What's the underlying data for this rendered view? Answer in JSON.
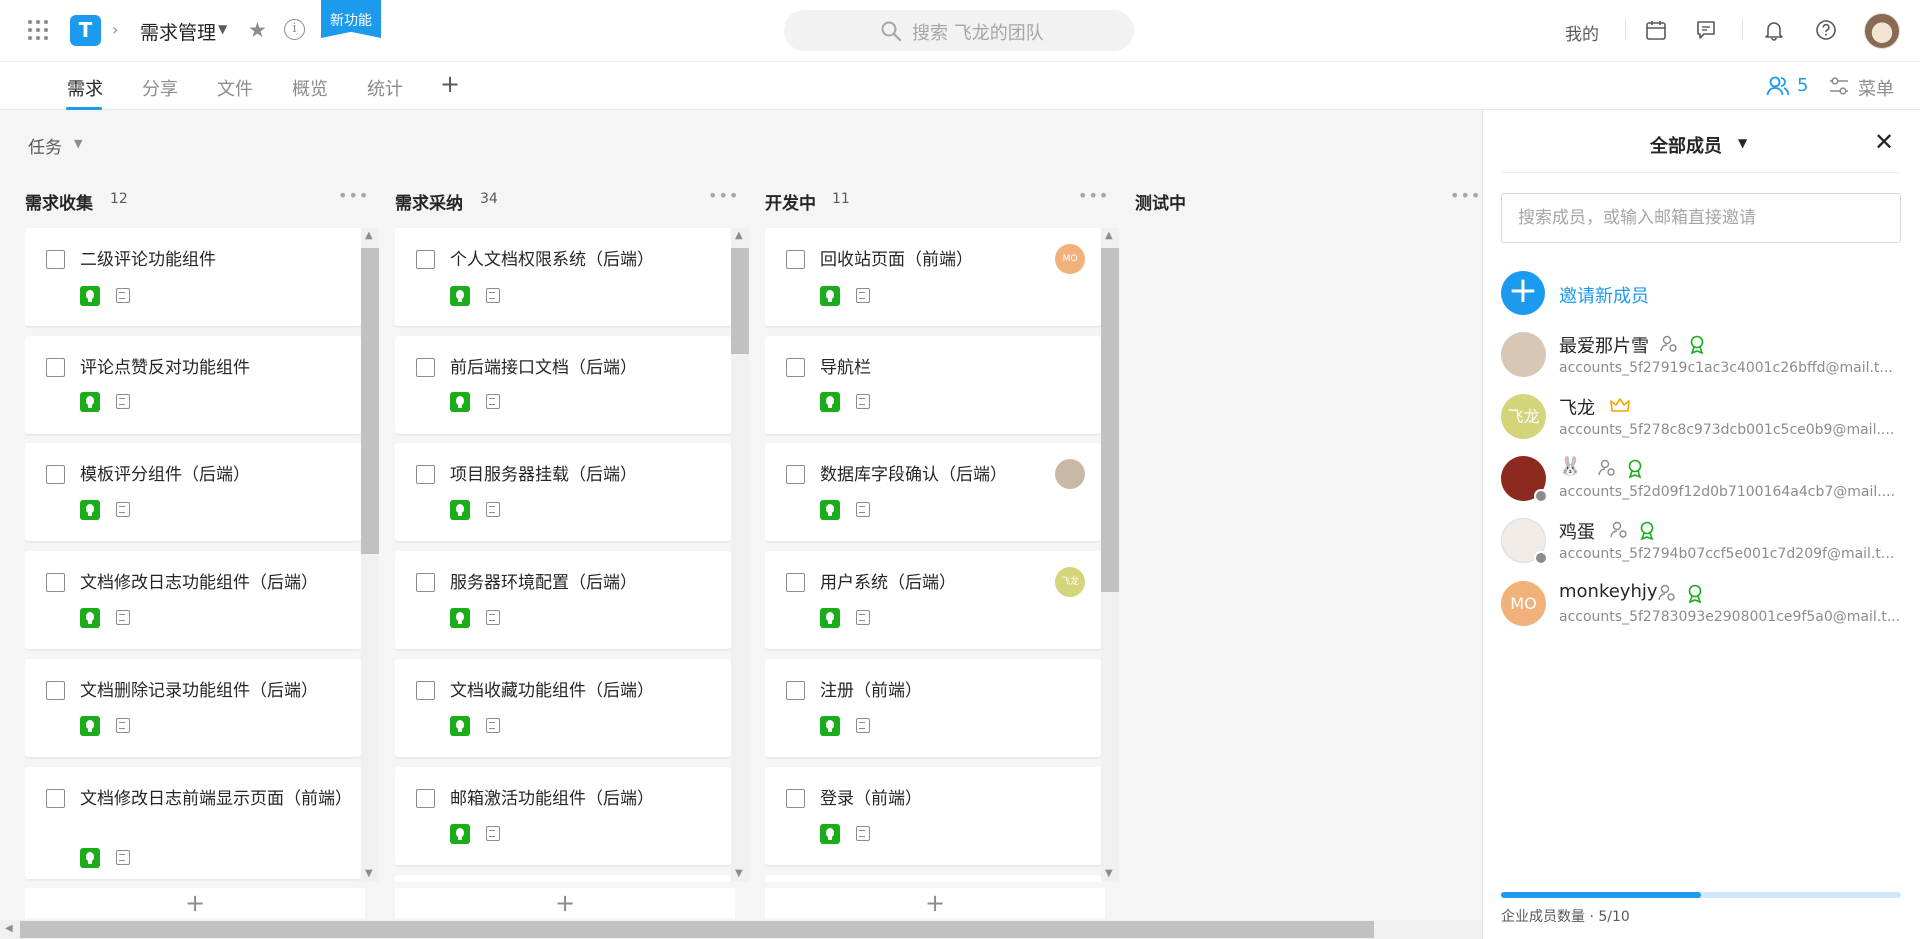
{
  "header": {
    "project_name": "需求管理",
    "new_feature_badge": "新功能",
    "search_placeholder": "搜索 飞龙的团队",
    "mine_label": "我的",
    "logo_letter": "T"
  },
  "tabs": [
    {
      "label": "需求",
      "active": true
    },
    {
      "label": "分享",
      "active": false
    },
    {
      "label": "文件",
      "active": false
    },
    {
      "label": "概览",
      "active": false
    },
    {
      "label": "统计",
      "active": false
    }
  ],
  "toolbar": {
    "tab_add": "+",
    "members_count": "5",
    "menu_label": "菜单"
  },
  "board": {
    "filter_label": "任务",
    "columns": [
      {
        "title": "需求收集",
        "count": "12",
        "cards": [
          {
            "title": "二级评论功能组件"
          },
          {
            "title": "评论点赞反对功能组件"
          },
          {
            "title": "模板评分组件（后端）"
          },
          {
            "title": "文档修改日志功能组件（后端）"
          },
          {
            "title": "文档删除记录功能组件（后端）"
          },
          {
            "title": "文档修改日志前端显示页面（前端）"
          }
        ]
      },
      {
        "title": "需求采纳",
        "count": "34",
        "cards": [
          {
            "title": "个人文档权限系统（后端）"
          },
          {
            "title": "前后端接口文档（后端）"
          },
          {
            "title": "项目服务器挂载（后端）"
          },
          {
            "title": "服务器环境配置（后端）"
          },
          {
            "title": "文档收藏功能组件（后端）"
          },
          {
            "title": "邮箱激活功能组件（后端）"
          }
        ]
      },
      {
        "title": "开发中",
        "count": "11",
        "cards": [
          {
            "title": "回收站页面（前端）",
            "assignee": "MO",
            "assignee_color": "#f0b27a"
          },
          {
            "title": "导航栏"
          },
          {
            "title": "数据库字段确认（后端）",
            "assignee": "",
            "assignee_color": "#c9b8a6"
          },
          {
            "title": "用户系统（后端）",
            "assignee": "飞龙",
            "assignee_color": "#d4d47a"
          },
          {
            "title": "注册（前端）"
          },
          {
            "title": "登录（前端）"
          }
        ]
      },
      {
        "title": "测试中",
        "count": "",
        "cards": []
      }
    ],
    "add_card": "+"
  },
  "panel": {
    "title": "全部成员",
    "search_placeholder": "搜索成员，或输入邮箱直接邀请",
    "invite_label": "邀请新成员",
    "members": [
      {
        "name": "最爱那片雪",
        "email": "accounts_5f27919c1ac3c4001c26bffd@mail.t...",
        "avatar_text": "",
        "avatar_color": "#d8c7b4",
        "role": "member"
      },
      {
        "name": "飞龙",
        "email": "accounts_5f278c8c973dcb001c5ce0b9@mail....",
        "avatar_text": "飞龙",
        "avatar_color": "#d4d47a",
        "role": "owner"
      },
      {
        "name": "🐰",
        "email": "accounts_5f2d09f12d0b7100164a4cb7@mail....",
        "avatar_text": "",
        "avatar_color": "#8b2a1f",
        "role": "member"
      },
      {
        "name": "鸡蛋",
        "email": "accounts_5f2794b07ccf5e001c7d209f@mail.t...",
        "avatar_text": "",
        "avatar_color": "#f0ebe6",
        "role": "member"
      },
      {
        "name": "monkeyhjy",
        "email": "accounts_5f2783093e2908001ce9f5a0@mail.t...",
        "avatar_text": "MO",
        "avatar_color": "#f0b27a",
        "role": "member"
      }
    ],
    "quota_label": "企业成员数量 · 5/10",
    "quota_used": 5,
    "quota_total": 10
  },
  "colors": {
    "accent": "#1b9aee",
    "task_green": "#1aad19"
  }
}
